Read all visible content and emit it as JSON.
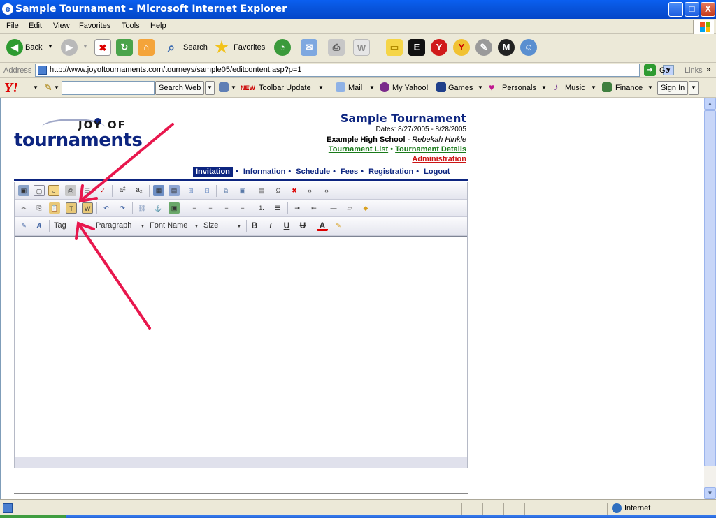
{
  "window": {
    "title": "Sample Tournament - Microsoft Internet Explorer",
    "controls": [
      "_",
      "□",
      "X"
    ]
  },
  "menu": [
    "File",
    "Edit",
    "View",
    "Favorites",
    "Tools",
    "Help"
  ],
  "toolbar": {
    "back": "Back",
    "search": "Search",
    "favorites": "Favorites"
  },
  "address": {
    "label": "Address",
    "url": "http://www.joyoftournaments.com/tourneys/sample05/editcontent.asp?p=1",
    "go": "Go",
    "links": "Links"
  },
  "yahoo": {
    "logo": "Y!",
    "search_button": "Search Web",
    "new_badge": "NEW",
    "toolbar_update": "Toolbar Update",
    "mail": "Mail",
    "my_yahoo": "My Yahoo!",
    "games": "Games",
    "personals": "Personals",
    "music": "Music",
    "finance": "Finance",
    "sign_in": "Sign In"
  },
  "logo": {
    "joy": "JOY OF",
    "tournaments": "tournaments"
  },
  "tournament": {
    "title": "Sample Tournament",
    "dates": "Dates: 8/27/2005 - 8/28/2005",
    "school": "Example High School",
    "separator": " - ",
    "contact": "Rebekah Hinkle",
    "link_list": "Tournament List",
    "link_details": "Tournament Details",
    "admin": "Administration"
  },
  "nav": {
    "invitation": "Invitation",
    "information": "Information",
    "schedule": "Schedule",
    "fees": "Fees",
    "registration": "Registration",
    "logout": "Logout"
  },
  "editor": {
    "tag_label": "Tag",
    "paragraph": "Paragraph",
    "font_name": "Font Name",
    "size": "Size",
    "bold": "B",
    "italic": "i",
    "underline": "U",
    "strike": "U",
    "superscript": "a²",
    "subscript": "a₂"
  },
  "status": {
    "zone": "Internet"
  },
  "colors": {
    "brand_navy": "#0d2580",
    "link_green": "#1a7a1a",
    "admin_red": "#cc1414",
    "arrow_pink": "#e8174d"
  }
}
